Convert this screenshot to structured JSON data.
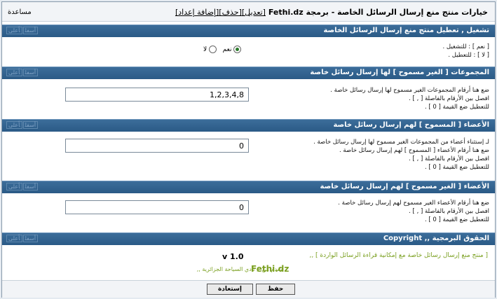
{
  "header": {
    "help": "مساعدة",
    "title": "خيارات منتج منع إرسال الرسائل الخاصة - برمجة Fethi.dz",
    "links": [
      "[تعديل]",
      "[حذف]",
      "[إضافة إعداد]"
    ]
  },
  "section_buttons": [
    "أعلى",
    "أسفل"
  ],
  "sections": [
    {
      "title": "تشغيل , تعطيل منتج منع إرسال الرسائل الخاصة",
      "lines": [
        "[ نعم ] : للتشغيل .",
        "[ لا ] : للتعطيل ."
      ],
      "radio_yes": "نعم",
      "radio_no": "لا"
    },
    {
      "title": "المجموعات [ الغير مسموح ] لها إرسال رسائل خاصة",
      "lines": [
        "ضع هنا أرقام المجموعات الغير مسموح لها إرسال رسائل خاصة .",
        "افصل بين الأرقام بالفاصلة [ , ] .",
        "للتعطيل ضع القيمة [ 0 ] ."
      ],
      "value": "1,2,3,4,8"
    },
    {
      "title": "الأعضاء [ المسموح ] لهم إرسال رسائل خاصة",
      "lines": [
        "لـ إستثناء أعضاء من المجموعات الغير مسموح لها إرسال رسائل خاصة .",
        "ضع هنا أرقام الأعضاء [ المسموح ] لهم إرسال رسائل خاصة .",
        "افصل بين الأرقام بالفاصلة [ , ] .",
        "للتعطيل ضع القيمة [ 0 ] ."
      ],
      "value": "0"
    },
    {
      "title": "الأعضاء [ الغير مسموح ] لهم إرسال رسائل خاصة",
      "lines": [
        "ضع هنا أرقام الأعضاء الغير مسموح لهم إرسال رسائل خاصة .",
        "افصل بين الأرقام بالفاصلة [ , ] .",
        "للتعطيل ضع القيمة [ 0 ] ."
      ],
      "value": "0"
    },
    {
      "title": "الحقوق البرمجية ,, Copyright"
    }
  ],
  "copyright": {
    "description": "[ منتج منع إرسال رسائل خاصة مع إمكانية قراءة الرسائل الواردة ] ,,",
    "version": "v 1.0",
    "author": "Fethi.dz",
    "offered": "مقدم من ,, نادي السياحة الجزائرية ,,"
  },
  "buttons": {
    "save": "حفظ",
    "restore": "إستعادة"
  },
  "colors": {
    "header_bg": "#2b5a86",
    "accent_green": "#7ba021"
  }
}
